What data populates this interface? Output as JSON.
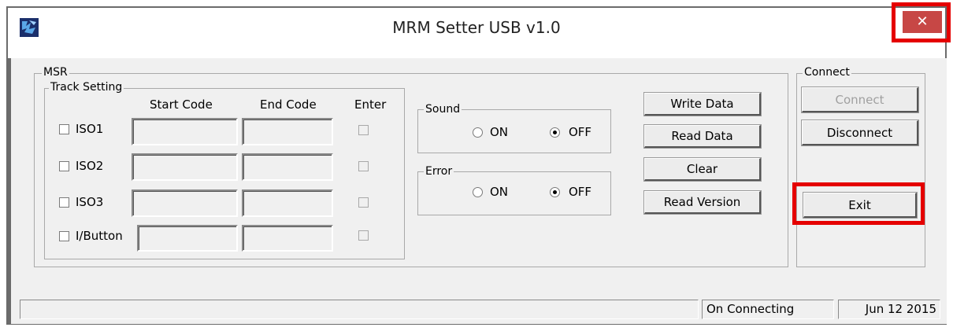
{
  "window": {
    "title": "MRM Setter USB v1.0",
    "app_icon": "app-icon",
    "close_glyph": "✕"
  },
  "msr": {
    "label": "MSR",
    "track_setting": {
      "label": "Track Setting",
      "headers": {
        "start_code": "Start Code",
        "end_code": "End Code",
        "enter": "Enter"
      },
      "tracks": [
        {
          "label": "ISO1",
          "checked": false
        },
        {
          "label": "ISO2",
          "checked": false
        },
        {
          "label": "ISO3",
          "checked": false
        },
        {
          "label": "I/Button",
          "checked": false
        }
      ]
    },
    "sound": {
      "label": "Sound",
      "on_label": "ON",
      "off_label": "OFF",
      "selected": "OFF"
    },
    "error": {
      "label": "Error",
      "on_label": "ON",
      "off_label": "OFF",
      "selected": "OFF"
    },
    "buttons": {
      "write_data": "Write Data",
      "read_data": "Read Data",
      "clear": "Clear",
      "read_version": "Read Version"
    }
  },
  "connect": {
    "label": "Connect",
    "connect_button": "Connect",
    "disconnect_button": "Disconnect",
    "exit_button": "Exit"
  },
  "statusbar": {
    "status": "On Connecting",
    "date": "Jun 12 2015"
  },
  "colors": {
    "close_button": "#c74745",
    "highlight": "#e50000"
  }
}
